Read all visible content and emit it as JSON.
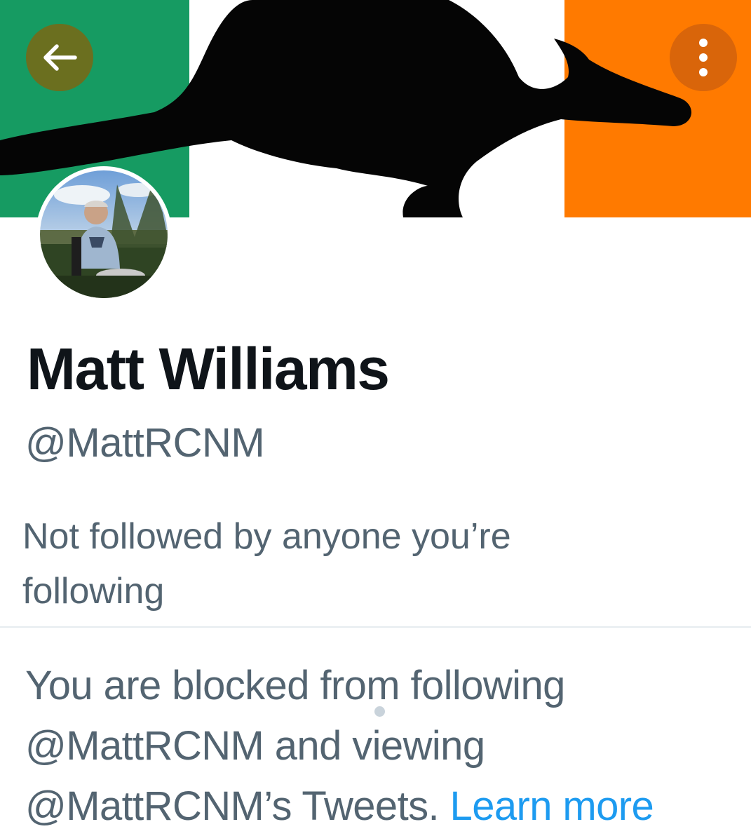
{
  "header": {
    "back_icon": "arrow-left-icon",
    "more_icon": "more-vertical-icon",
    "back_button_color": "#6b6f1f",
    "more_button_color": "#d9650a"
  },
  "banner": {
    "description_colors": {
      "green": "#169b62",
      "white": "#ffffff",
      "orange": "#ff7a00",
      "kangaroo": "#000000"
    }
  },
  "profile": {
    "name": "Matt Williams",
    "handle": "@MattRCNM",
    "followers_note": "Not followed by anyone you’re following"
  },
  "blocked": {
    "line1": "You are blocked from following",
    "line2": "@MattRCNM and viewing",
    "line3": "@MattRCNM’s Tweets.",
    "learn_more": "Learn more",
    "link_color": "#1d9bf0"
  }
}
